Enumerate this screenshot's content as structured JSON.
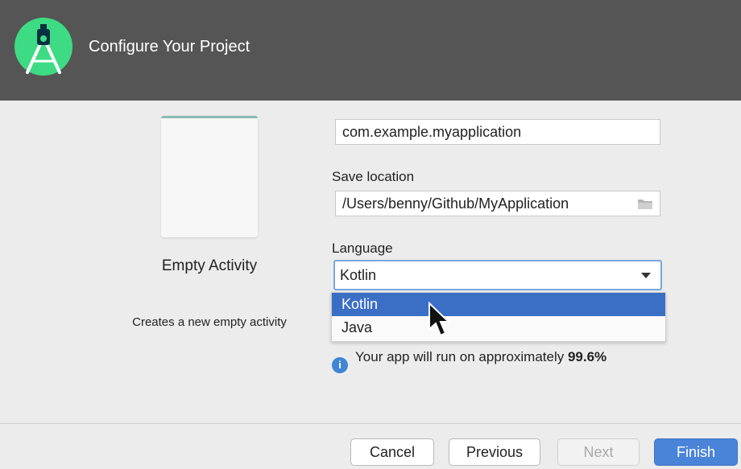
{
  "header": {
    "title": "Configure Your Project",
    "logo_icon": "android-studio-logo-icon"
  },
  "template": {
    "name": "Empty Activity",
    "description": "Creates a new empty activity"
  },
  "form": {
    "package_name_value": "com.example.myapplication",
    "save_location_label": "Save location",
    "save_location_value": "/Users/benny/Github/MyApplication",
    "folder_icon": "folder-icon",
    "language_label": "Language",
    "language_selected": "Kotlin",
    "language_options": [
      "Kotlin",
      "Java"
    ]
  },
  "info": {
    "icon": "info-icon",
    "text_prefix": "Your app will run on approximately ",
    "percentage": "99.6%"
  },
  "footer": {
    "cancel_label": "Cancel",
    "previous_label": "Previous",
    "next_label": "Next",
    "finish_label": "Finish"
  },
  "colors": {
    "header_bg": "#555555",
    "selection_blue": "#3b6fc6",
    "primary_button": "#4a84d9",
    "android_green": "#3ddc84"
  }
}
